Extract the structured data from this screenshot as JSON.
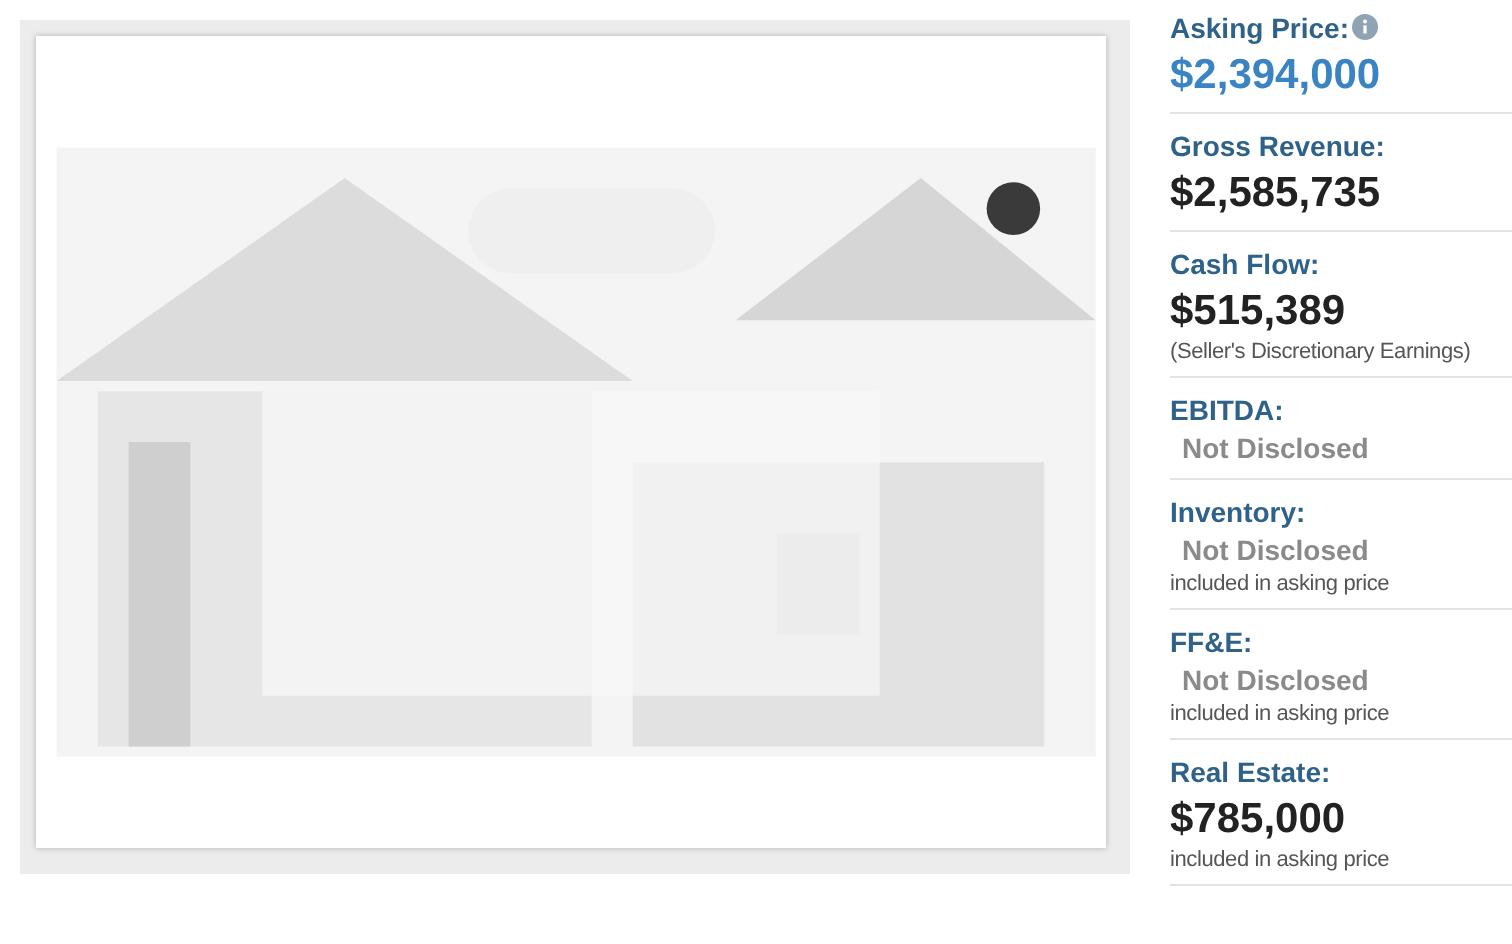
{
  "financials": [
    {
      "label": "Asking Price:",
      "info": true,
      "kind": "highlight",
      "value": "$2,394,000"
    },
    {
      "label": "Gross Revenue:",
      "kind": "amount",
      "value": "$2,585,735"
    },
    {
      "label": "Cash Flow:",
      "kind": "amount",
      "value": "$515,389",
      "note": "(Seller's Discretionary Earnings)"
    },
    {
      "label": "EBITDA:",
      "kind": "undisclosed",
      "value": "Not Disclosed"
    },
    {
      "label": "Inventory:",
      "kind": "undisclosed",
      "value": "Not Disclosed",
      "note": "included in asking price"
    },
    {
      "label": "FF&E:",
      "kind": "undisclosed",
      "value": "Not Disclosed",
      "note": "included in asking price"
    },
    {
      "label": "Real Estate:",
      "kind": "amount",
      "value": "$785,000",
      "note": "included in asking price"
    }
  ]
}
